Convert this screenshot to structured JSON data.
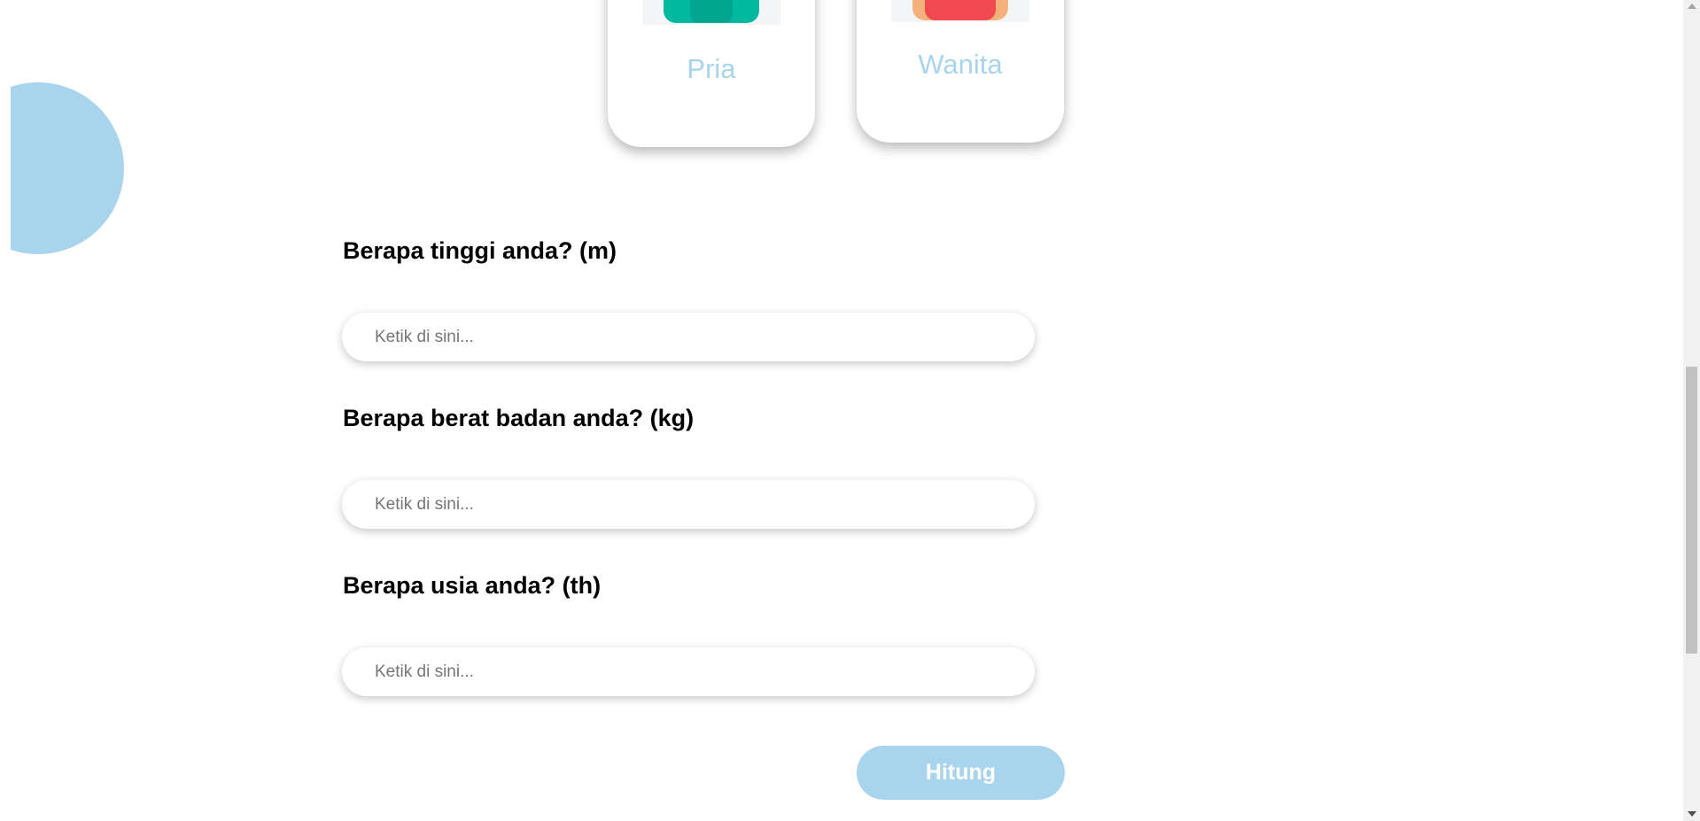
{
  "colors": {
    "accent": "#a8d4ee",
    "male_shirt": "#00b99f",
    "female_shirt": "#f2484f",
    "text": "#000000"
  },
  "gender_options": [
    {
      "label": "Pria",
      "icon": "male-avatar-icon"
    },
    {
      "label": "Wanita",
      "icon": "female-avatar-icon"
    }
  ],
  "form": {
    "height": {
      "question": "Berapa tinggi anda? (m)",
      "placeholder": "Ketik di sini...",
      "value": ""
    },
    "weight": {
      "question": "Berapa berat badan anda? (kg)",
      "placeholder": "Ketik di sini...",
      "value": ""
    },
    "age": {
      "question": "Berapa usia anda? (th)",
      "placeholder": "Ketik di sini...",
      "value": ""
    },
    "submit_label": "Hitung"
  }
}
